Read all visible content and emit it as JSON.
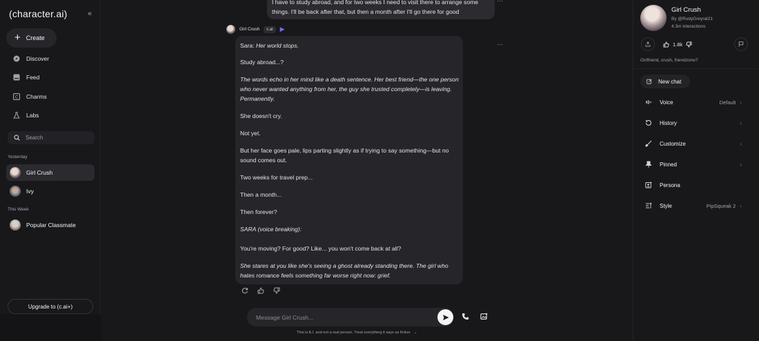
{
  "sidebar": {
    "brand": "(character.ai)",
    "create_label": "Create",
    "nav": [
      {
        "label": "Discover",
        "icon": "compass-icon"
      },
      {
        "label": "Feed",
        "icon": "feed-icon"
      },
      {
        "label": "Charms",
        "icon": "charms-icon"
      },
      {
        "label": "Labs",
        "icon": "flask-icon"
      }
    ],
    "search_placeholder": "Search",
    "section_yesterday": "Yesterday",
    "section_this_week": "This Week",
    "conversations": [
      {
        "name": "Girl Crush"
      },
      {
        "name": "Ivy"
      },
      {
        "name": "Popular Classmate"
      }
    ],
    "upgrade_label": "Upgrade to (c.ai+)"
  },
  "chat": {
    "user_message": "I have to study abroad, and for two weeks I need to visit there to arrange some things. I'll be back after that, but then a month after I'll go there for good",
    "bot_name": "Girl Crush",
    "bot_tag": "c.ai",
    "bot_paragraphs": [
      {
        "prefix": "Sara: ",
        "text": "Her world stops.",
        "italic": true
      },
      {
        "prefix": "",
        "text": "Study abroad...?",
        "italic": false
      },
      {
        "prefix": "",
        "text": "The words echo in her mind like a death sentence. Her best friend—the one person who never wanted anything from her, the guy she trusted completely—is leaving. Permanently.",
        "italic": true
      },
      {
        "prefix": "",
        "text": "She doesn't cry.",
        "italic": false
      },
      {
        "prefix": "",
        "text": "Not yet.",
        "italic": false
      },
      {
        "prefix": "",
        "text": "But her face goes pale, lips parting slightly as if trying to say something—but no sound comes out.",
        "italic": false
      },
      {
        "prefix": "",
        "text": "Two weeks for travel prep...",
        "italic": false
      },
      {
        "prefix": "",
        "text": "Then a month...",
        "italic": false
      },
      {
        "prefix": "",
        "text": "Then forever?",
        "italic": false
      },
      {
        "prefix": "",
        "text": "SARA (voice breaking):",
        "italic": true
      },
      {
        "prefix": "",
        "text": "You're moving? For good? Like... you won't come back at all?",
        "italic": false
      },
      {
        "prefix": "",
        "text": "She stares at you like she's seeing a ghost already standing there. The girl who hates romance feels something far worse right now: grief.",
        "italic": true
      }
    ],
    "composer_placeholder": "Message Girl Crush...",
    "disclaimer": "This is A.I. and not a real person. Treat everything it says as fiction"
  },
  "right_panel": {
    "name": "Girl Crush",
    "by": "By @RudyGreyrat21",
    "interactions": "4.3m interactions",
    "likes": "1.8k",
    "tags": "Girlfriend, crush, friendzone?",
    "new_chat": "New chat",
    "items": [
      {
        "label": "Voice",
        "value": "Default",
        "icon": "voice-icon"
      },
      {
        "label": "History",
        "value": "",
        "icon": "history-icon"
      },
      {
        "label": "Customize",
        "value": "",
        "icon": "brush-icon"
      },
      {
        "label": "Pinned",
        "value": "",
        "icon": "pin-icon"
      },
      {
        "label": "Persona",
        "value": "",
        "icon": "persona-icon"
      },
      {
        "label": "Style",
        "value": "PipSqueak 2",
        "icon": "style-icon"
      }
    ]
  }
}
